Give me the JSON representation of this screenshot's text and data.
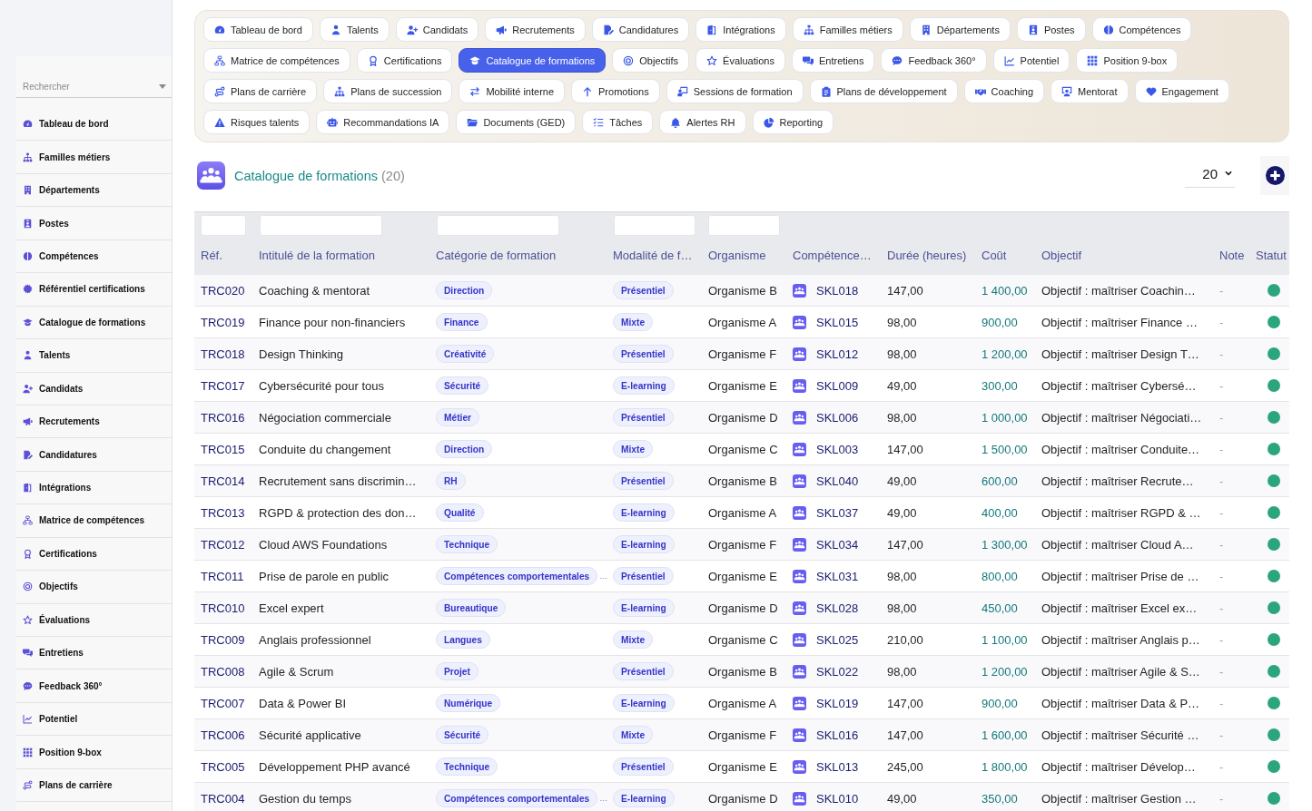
{
  "sidebar": {
    "search": {
      "placeholder": "Rechercher"
    },
    "items": [
      "Tableau de bord",
      "Familles métiers",
      "Départements",
      "Postes",
      "Compétences",
      "Référentiel certifications",
      "Catalogue de formations",
      "Talents",
      "Candidats",
      "Recrutements",
      "Candidatures",
      "Intégrations",
      "Matrice de compétences",
      "Certifications",
      "Objectifs",
      "Évaluations",
      "Entretiens",
      "Feedback 360°",
      "Potentiel",
      "Position 9-box",
      "Plans de carrière"
    ]
  },
  "nav": {
    "rows": [
      {
        "tabs": [
          {
            "label": "Tableau de bord",
            "selected": false
          },
          {
            "label": "Talents",
            "selected": false
          },
          {
            "label": "Candidats",
            "selected": false
          },
          {
            "label": "Recrutements",
            "selected": false
          },
          {
            "label": "Candidatures",
            "selected": false
          },
          {
            "label": "Intégrations",
            "selected": false
          },
          {
            "label": "Familles métiers",
            "selected": false
          },
          {
            "label": "Départements",
            "selected": false
          },
          {
            "label": "Postes",
            "selected": false
          },
          {
            "label": "Compétences",
            "selected": false
          }
        ]
      },
      {
        "tabs": [
          {
            "label": "Matrice de compétences",
            "selected": false
          },
          {
            "label": "Certifications",
            "selected": false
          },
          {
            "label": "Catalogue de formations",
            "selected": true
          },
          {
            "label": "Objectifs",
            "selected": false
          },
          {
            "label": "Évaluations",
            "selected": false
          },
          {
            "label": "Entretiens",
            "selected": false
          },
          {
            "label": "Feedback 360°",
            "selected": false
          },
          {
            "label": "Potentiel",
            "selected": false
          },
          {
            "label": "Position 9-box",
            "selected": false
          }
        ]
      },
      {
        "tabs": [
          {
            "label": "Plans de carrière",
            "selected": false
          },
          {
            "label": "Plans de succession",
            "selected": false
          },
          {
            "label": "Mobilité interne",
            "selected": false
          },
          {
            "label": "Promotions",
            "selected": false
          },
          {
            "label": "Sessions de formation",
            "selected": false
          },
          {
            "label": "Plans de développement",
            "selected": false
          },
          {
            "label": "Coaching",
            "selected": false
          },
          {
            "label": "Mentorat",
            "selected": false
          },
          {
            "label": "Engagement",
            "selected": false
          }
        ]
      },
      {
        "tabs": [
          {
            "label": "Risques talents",
            "selected": false
          },
          {
            "label": "Recommandations IA",
            "selected": false
          },
          {
            "label": "Documents (GED)",
            "selected": false
          },
          {
            "label": "Tâches",
            "selected": false
          },
          {
            "label": "Alertes RH",
            "selected": false
          },
          {
            "label": "Reporting",
            "selected": false
          }
        ]
      }
    ]
  },
  "header": {
    "title": "Catalogue de formations",
    "count": "(20)",
    "page_size": "20"
  },
  "table": {
    "columns": [
      {
        "label": "Réf.",
        "filter": true
      },
      {
        "label": "Intitulé de la formation",
        "filter": true
      },
      {
        "label": "Catégorie de formation",
        "filter": true
      },
      {
        "label": "Modalité de f…",
        "filter": true
      },
      {
        "label": "Organisme",
        "filter": true
      },
      {
        "label": "Compétence…",
        "filter": false
      },
      {
        "label": "Durée (heures)",
        "filter": false
      },
      {
        "label": "Coût",
        "filter": false
      },
      {
        "label": "Objectif",
        "filter": false
      },
      {
        "label": "Note",
        "filter": false
      },
      {
        "label": "Statut",
        "filter": false
      }
    ],
    "rows": [
      {
        "ref": "TRC020",
        "title": "Coaching & mentorat",
        "category": "Direction",
        "modality": "Présentiel",
        "organism": "Organisme B",
        "skill": "SKL018",
        "duration": "147,00",
        "cost": "1 400,00",
        "objective": "Objectif : maîtriser Coachin…",
        "note": "-",
        "active": true
      },
      {
        "ref": "TRC019",
        "title": "Finance pour non-financiers",
        "category": "Finance",
        "modality": "Mixte",
        "organism": "Organisme A",
        "skill": "SKL015",
        "duration": "98,00",
        "cost": "900,00",
        "objective": "Objectif : maîtriser Finance …",
        "note": "-",
        "active": true
      },
      {
        "ref": "TRC018",
        "title": "Design Thinking",
        "category": "Créativité",
        "modality": "Présentiel",
        "organism": "Organisme F",
        "skill": "SKL012",
        "duration": "98,00",
        "cost": "1 200,00",
        "objective": "Objectif : maîtriser Design T…",
        "note": "-",
        "active": true
      },
      {
        "ref": "TRC017",
        "title": "Cybersécurité pour tous",
        "category": "Sécurité",
        "modality": "E-learning",
        "organism": "Organisme E",
        "skill": "SKL009",
        "duration": "49,00",
        "cost": "300,00",
        "objective": "Objectif : maîtriser Cybersé…",
        "note": "-",
        "active": true
      },
      {
        "ref": "TRC016",
        "title": "Négociation commerciale",
        "category": "Métier",
        "modality": "Présentiel",
        "organism": "Organisme D",
        "skill": "SKL006",
        "duration": "98,00",
        "cost": "1 000,00",
        "objective": "Objectif : maîtriser Négociati…",
        "note": "-",
        "active": true
      },
      {
        "ref": "TRC015",
        "title": "Conduite du changement",
        "category": "Direction",
        "modality": "Mixte",
        "organism": "Organisme C",
        "skill": "SKL003",
        "duration": "147,00",
        "cost": "1 500,00",
        "objective": "Objectif : maîtriser Conduite…",
        "note": "-",
        "active": true
      },
      {
        "ref": "TRC014",
        "title": "Recrutement sans discrimin…",
        "category": "RH",
        "modality": "Présentiel",
        "organism": "Organisme B",
        "skill": "SKL040",
        "duration": "49,00",
        "cost": "600,00",
        "objective": "Objectif : maîtriser Recrute…",
        "note": "-",
        "active": true
      },
      {
        "ref": "TRC013",
        "title": "RGPD & protection des don…",
        "category": "Qualité",
        "modality": "E-learning",
        "organism": "Organisme A",
        "skill": "SKL037",
        "duration": "49,00",
        "cost": "400,00",
        "objective": "Objectif : maîtriser RGPD & …",
        "note": "-",
        "active": true
      },
      {
        "ref": "TRC012",
        "title": "Cloud AWS Foundations",
        "category": "Technique",
        "modality": "E-learning",
        "organism": "Organisme F",
        "skill": "SKL034",
        "duration": "147,00",
        "cost": "1 300,00",
        "objective": "Objectif : maîtriser Cloud A…",
        "note": "-",
        "active": true
      },
      {
        "ref": "TRC011",
        "title": "Prise de parole en public",
        "category": "Compétences comportementales",
        "category_overflow": "…",
        "modality": "Présentiel",
        "organism": "Organisme E",
        "skill": "SKL031",
        "duration": "98,00",
        "cost": "800,00",
        "objective": "Objectif : maîtriser Prise de …",
        "note": "-",
        "active": true
      },
      {
        "ref": "TRC010",
        "title": "Excel expert",
        "category": "Bureautique",
        "modality": "E-learning",
        "organism": "Organisme D",
        "skill": "SKL028",
        "duration": "98,00",
        "cost": "450,00",
        "objective": "Objectif : maîtriser Excel ex…",
        "note": "-",
        "active": true
      },
      {
        "ref": "TRC009",
        "title": "Anglais professionnel",
        "category": "Langues",
        "modality": "Mixte",
        "organism": "Organisme C",
        "skill": "SKL025",
        "duration": "210,00",
        "cost": "1 100,00",
        "objective": "Objectif : maîtriser Anglais p…",
        "note": "-",
        "active": true
      },
      {
        "ref": "TRC008",
        "title": "Agile & Scrum",
        "category": "Projet",
        "modality": "Présentiel",
        "organism": "Organisme B",
        "skill": "SKL022",
        "duration": "98,00",
        "cost": "1 200,00",
        "objective": "Objectif : maîtriser Agile & S…",
        "note": "-",
        "active": true
      },
      {
        "ref": "TRC007",
        "title": "Data & Power BI",
        "category": "Numérique",
        "modality": "E-learning",
        "organism": "Organisme A",
        "skill": "SKL019",
        "duration": "147,00",
        "cost": "900,00",
        "objective": "Objectif : maîtriser Data & P…",
        "note": "-",
        "active": true
      },
      {
        "ref": "TRC006",
        "title": "Sécurité applicative",
        "category": "Sécurité",
        "modality": "Mixte",
        "organism": "Organisme F",
        "skill": "SKL016",
        "duration": "147,00",
        "cost": "1 600,00",
        "objective": "Objectif : maîtriser Sécurité …",
        "note": "-",
        "active": true
      },
      {
        "ref": "TRC005",
        "title": "Développement PHP avancé",
        "category": "Technique",
        "modality": "Présentiel",
        "organism": "Organisme E",
        "skill": "SKL013",
        "duration": "245,00",
        "cost": "1 800,00",
        "objective": "Objectif : maîtriser Dévelop…",
        "note": "-",
        "active": true
      },
      {
        "ref": "TRC004",
        "title": "Gestion du temps",
        "category": "Compétences comportementales",
        "category_overflow": "…",
        "modality": "E-learning",
        "organism": "Organisme D",
        "skill": "SKL010",
        "duration": "49,00",
        "cost": "350,00",
        "objective": "Objectif : maîtriser Gestion …",
        "note": "-",
        "active": true
      }
    ]
  }
}
